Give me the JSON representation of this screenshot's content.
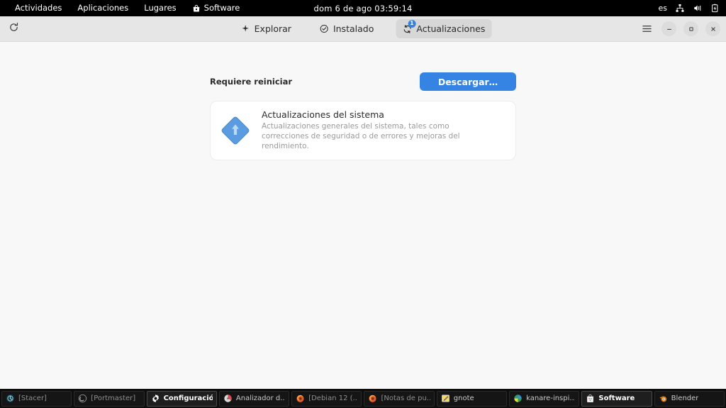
{
  "topbar": {
    "activities": "Actividades",
    "applications": "Aplicaciones",
    "places": "Lugares",
    "app_name": "Software",
    "app_icon": "shopping-bag-icon",
    "clock": "dom  6 de ago  03:59:14",
    "keyboard_layout": "es",
    "indicators": [
      "network-wired-icon",
      "volume-icon",
      "battery-charging-icon"
    ]
  },
  "headerbar": {
    "refresh_icon": "refresh-icon",
    "tabs": [
      {
        "label": "Explorar",
        "icon": "sparkle-icon",
        "active": false,
        "badge": null
      },
      {
        "label": "Instalado",
        "icon": "check-circle-icon",
        "active": false,
        "badge": null
      },
      {
        "label": "Actualizaciones",
        "icon": "updates-refresh-icon",
        "active": true,
        "badge": "1"
      }
    ],
    "menu_icon": "hamburger-menu-icon",
    "minimize_icon": "minimize-icon",
    "maximize_icon": "maximize-icon",
    "close_icon": "close-icon"
  },
  "content": {
    "section_title": "Requiere reiniciar",
    "download_label": "Descargar…",
    "update_card": {
      "icon": "system-update-diamond-icon",
      "title": "Actualizaciones del sistema",
      "description": "Actualizaciones generales del sistema, tales como correcciones de seguridad o de errores y mejoras del rendimiento."
    }
  },
  "taskbar": {
    "items": [
      {
        "label": "[Stacer]",
        "icon": "stacer-icon",
        "state": "minimized"
      },
      {
        "label": "[Portmaster]",
        "icon": "portmaster-icon",
        "state": "minimized"
      },
      {
        "label": "Configuración",
        "icon": "gear-icon",
        "state": "active"
      },
      {
        "label": "Analizador d...",
        "icon": "disk-analyzer-icon",
        "state": "normal"
      },
      {
        "label": "[Debian 12 (...",
        "icon": "firefox-icon",
        "state": "minimized"
      },
      {
        "label": "[Notas de pu...",
        "icon": "firefox-icon",
        "state": "minimized"
      },
      {
        "label": "gnote",
        "icon": "gnote-icon",
        "state": "normal"
      },
      {
        "label": "kanare-inspi...",
        "icon": "image-viewer-icon",
        "state": "normal"
      },
      {
        "label": "Software",
        "icon": "shopping-bag-icon",
        "state": "active"
      },
      {
        "label": "Blender",
        "icon": "blender-icon",
        "state": "normal"
      }
    ]
  },
  "colors": {
    "accent_blue": "#3584e4",
    "topbar_bg": "#000000",
    "header_bg": "#e6e6e6",
    "content_bg": "#f8f8f8",
    "card_bg": "#ffffff",
    "taskbar_bg": "#0d0d0d"
  }
}
